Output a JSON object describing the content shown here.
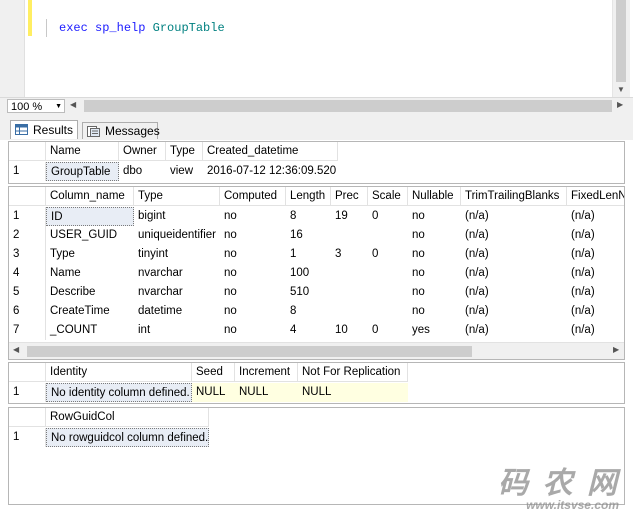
{
  "editor": {
    "code_kw1": "exec",
    "code_kw2": "sp_help",
    "code_obj": "GroupTable"
  },
  "zoom": {
    "value": "100 %"
  },
  "tabs": [
    {
      "label": "Results",
      "icon": "grid-icon",
      "active": true
    },
    {
      "label": "Messages",
      "icon": "messages-icon",
      "active": false
    }
  ],
  "object_info": {
    "headers": [
      "Name",
      "Owner",
      "Type",
      "Created_datetime"
    ],
    "rows": [
      {
        "n": "1",
        "cells": [
          "GroupTable",
          "dbo",
          "view",
          "2016-07-12 12:36:09.520"
        ]
      }
    ]
  },
  "columns_info": {
    "headers": [
      "Column_name",
      "Type",
      "Computed",
      "Length",
      "Prec",
      "Scale",
      "Nullable",
      "TrimTrailingBlanks",
      "FixedLenN"
    ],
    "rows": [
      {
        "n": "1",
        "cells": [
          "ID",
          "bigint",
          "no",
          "8",
          "19",
          "0",
          "no",
          "(n/a)",
          "(n/a)"
        ]
      },
      {
        "n": "2",
        "cells": [
          "USER_GUID",
          "uniqueidentifier",
          "no",
          "16",
          "",
          "",
          "no",
          "(n/a)",
          "(n/a)"
        ]
      },
      {
        "n": "3",
        "cells": [
          "Type",
          "tinyint",
          "no",
          "1",
          "3",
          "0",
          "no",
          "(n/a)",
          "(n/a)"
        ]
      },
      {
        "n": "4",
        "cells": [
          "Name",
          "nvarchar",
          "no",
          "100",
          "",
          "",
          "no",
          "(n/a)",
          "(n/a)"
        ]
      },
      {
        "n": "5",
        "cells": [
          "Describe",
          "nvarchar",
          "no",
          "510",
          "",
          "",
          "no",
          "(n/a)",
          "(n/a)"
        ]
      },
      {
        "n": "6",
        "cells": [
          "CreateTime",
          "datetime",
          "no",
          "8",
          "",
          "",
          "no",
          "(n/a)",
          "(n/a)"
        ]
      },
      {
        "n": "7",
        "cells": [
          "_COUNT",
          "int",
          "no",
          "4",
          "10",
          "0",
          "yes",
          "(n/a)",
          "(n/a)"
        ]
      }
    ]
  },
  "identity_info": {
    "headers": [
      "Identity",
      "Seed",
      "Increment",
      "Not For Replication"
    ],
    "rows": [
      {
        "n": "1",
        "cells": [
          "No identity column defined.",
          "NULL",
          "NULL",
          "NULL"
        ]
      }
    ]
  },
  "rowguid_info": {
    "headers": [
      "RowGuidCol"
    ],
    "rows": [
      {
        "n": "1",
        "cells": [
          "No rowguidcol column defined."
        ]
      }
    ]
  },
  "watermark": {
    "brand": "码 农 网",
    "url": "www.itsvse.com"
  },
  "colors": {
    "keyword": "#1c1cff",
    "object": "#008080",
    "null_bg": "#ffffe1",
    "selection_bg": "#e8edf5"
  }
}
